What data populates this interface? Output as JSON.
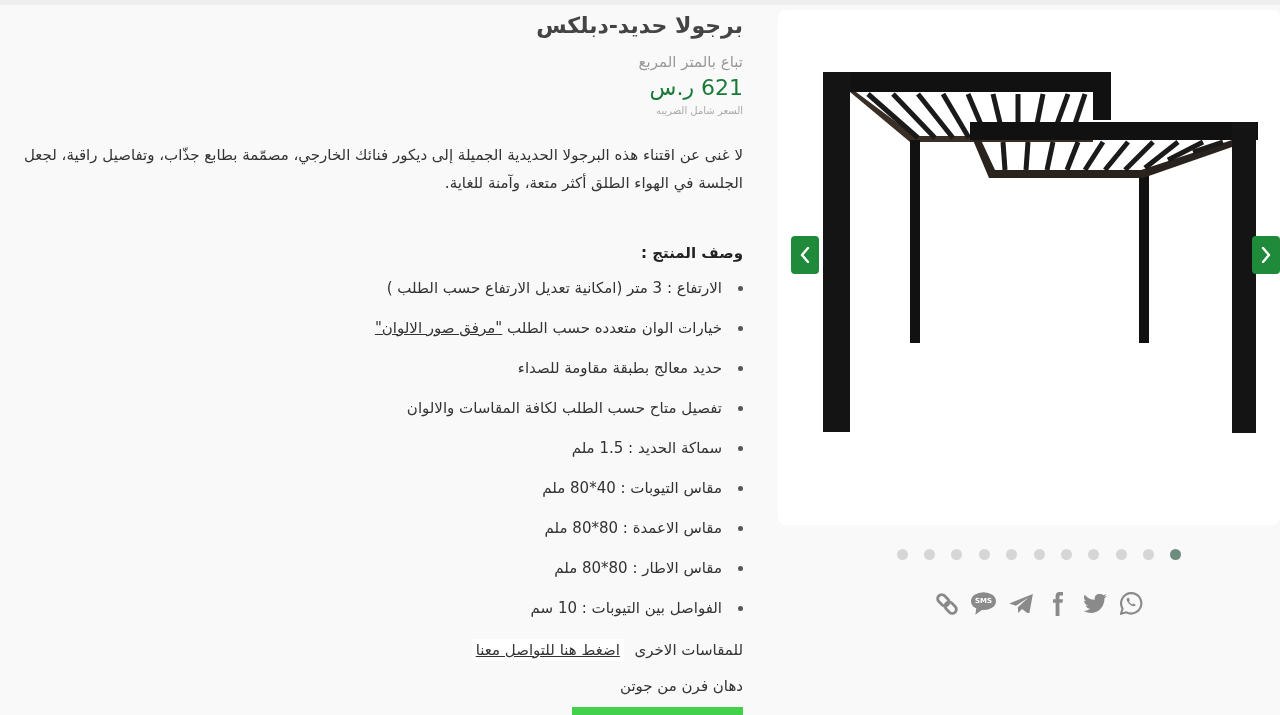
{
  "product": {
    "title": "برجولا حديد-دبلكس",
    "unit_note": "تباع بالمتر المربع",
    "price": "621 ر.س",
    "tax_note": "السعر شامل الضريبه"
  },
  "description": "لا غنى عن اقتناء هذه البرجولا الحديدية الجميلة إلى ديكور فنائك الخارجي، مصمّمة بطابع جذّاب، وتفاصيل راقية، لجعل الجلسة في الهواء الطلق أكثر متعة، وآمنة للغاية.",
  "specs": {
    "heading": "وصف المنتج :",
    "items": [
      {
        "text": "الارتفاع : 3 متر (امكانية تعديل الارتفاع حسب الطلب )"
      },
      {
        "text": "خيارات الوان متعدده حسب الطلب",
        "link": "\"مرفق صور الالوان\""
      },
      {
        "text": "حديد معالج بطبقة مقاومة للصداء"
      },
      {
        "text": "تفصيل متاح حسب الطلب لكافة المقاسات والالوان"
      },
      {
        "text": "سماكة الحديد : 1.5 ملم"
      },
      {
        "text": "مقاس التيوبات : 40*80 ملم"
      },
      {
        "text": "مقاس الاعمدة : 80*80 ملم"
      },
      {
        "text": "مقاس الاطار : 80*80 ملم"
      },
      {
        "text": "الفواصل بين التيوبات : 10 سم"
      }
    ]
  },
  "contact": {
    "text": "للمقاسات الاخرى",
    "link": "اضغط هنا للتواصل معنا"
  },
  "paint_note": "دهان فرن من جوتن",
  "gallery": {
    "slides": [
      {
        "selected": true
      },
      {
        "selected": false
      },
      {
        "selected": false
      },
      {
        "selected": false
      },
      {
        "selected": false
      },
      {
        "selected": false
      },
      {
        "selected": false
      },
      {
        "selected": false
      },
      {
        "selected": false
      },
      {
        "selected": false
      },
      {
        "selected": false
      }
    ]
  },
  "share": [
    {
      "kind": "whatsapp"
    },
    {
      "kind": "twitter"
    },
    {
      "kind": "facebook"
    },
    {
      "kind": "telegram"
    },
    {
      "kind": "sms",
      "label": "SMS"
    },
    {
      "kind": "link"
    }
  ]
}
